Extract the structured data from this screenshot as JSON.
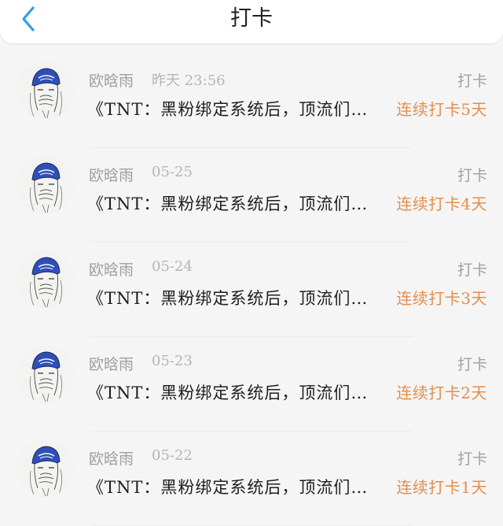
{
  "header": {
    "title": "打卡",
    "back_icon": "chevron-left-icon",
    "accent_color": "#2d9fe6"
  },
  "items": [
    {
      "username": "欧晗雨",
      "time": "昨天  23:56",
      "tag": "打卡",
      "title": "《TNT：黑粉绑定系统后，顶流们…",
      "streak": "连续打卡5天"
    },
    {
      "username": "欧晗雨",
      "time": "05-25",
      "tag": "打卡",
      "title": "《TNT：黑粉绑定系统后，顶流们…",
      "streak": "连续打卡4天"
    },
    {
      "username": "欧晗雨",
      "time": "05-24",
      "tag": "打卡",
      "title": "《TNT：黑粉绑定系统后，顶流们…",
      "streak": "连续打卡3天"
    },
    {
      "username": "欧晗雨",
      "time": "05-23",
      "tag": "打卡",
      "title": "《TNT：黑粉绑定系统后，顶流们…",
      "streak": "连续打卡2天"
    },
    {
      "username": "欧晗雨",
      "time": "05-22",
      "tag": "打卡",
      "title": "《TNT：黑粉绑定系统后，顶流们…",
      "streak": "连续打卡1天"
    }
  ],
  "colors": {
    "streak": "#e38e4f",
    "muted": "#9e9e9e",
    "avatar_hat": "#2f4fb8"
  }
}
